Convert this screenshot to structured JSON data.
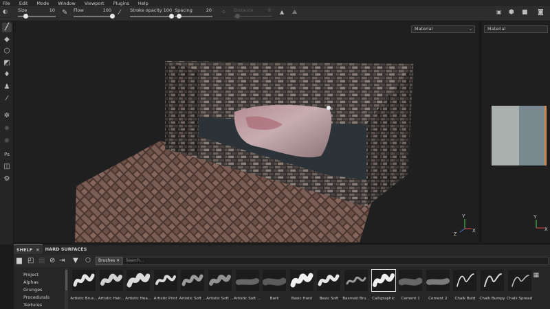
{
  "menu": [
    "File",
    "Edit",
    "Mode",
    "Window",
    "Viewport",
    "Plugins",
    "Help"
  ],
  "toolbar": {
    "size": {
      "label": "Size",
      "value": "10",
      "level": 0.2
    },
    "flow": {
      "label": "Flow",
      "value": "100",
      "level": 1.0
    },
    "stroke_opacity": {
      "label": "Stroke opacity",
      "value": "100",
      "level": 1.0
    },
    "spacing": {
      "label": "Spacing",
      "value": "20",
      "level": 0.12
    },
    "distance": {
      "label": "Distance",
      "value": "8",
      "level": 0.1
    }
  },
  "viewport": {
    "material_select": "Material"
  },
  "view2d": {
    "material_select": "Material"
  },
  "shelf": {
    "tabs": [
      {
        "label": "SHELF"
      },
      {
        "label": "HARD SURFACES"
      }
    ],
    "filter_chip": "Brushes",
    "search_placeholder": "Search...",
    "categories": [
      "Project",
      "Alphas",
      "Grunges",
      "Procedurals",
      "Textures"
    ],
    "brushes": [
      "Artistic Brus...",
      "Artistic Hair...",
      "Artistic Hea...",
      "Artistic Print",
      "Artistic Soft ...",
      "Artistic Soft ...",
      "Artistic Soft ...",
      "Bark",
      "Basic Hard",
      "Basic Soft",
      "Basmati Bru...",
      "Calligraphic",
      "Cement 1",
      "Cement 2",
      "Chalk Bold",
      "Chalk Bumpy",
      "Chalk Spread"
    ],
    "selected_brush": 11
  }
}
